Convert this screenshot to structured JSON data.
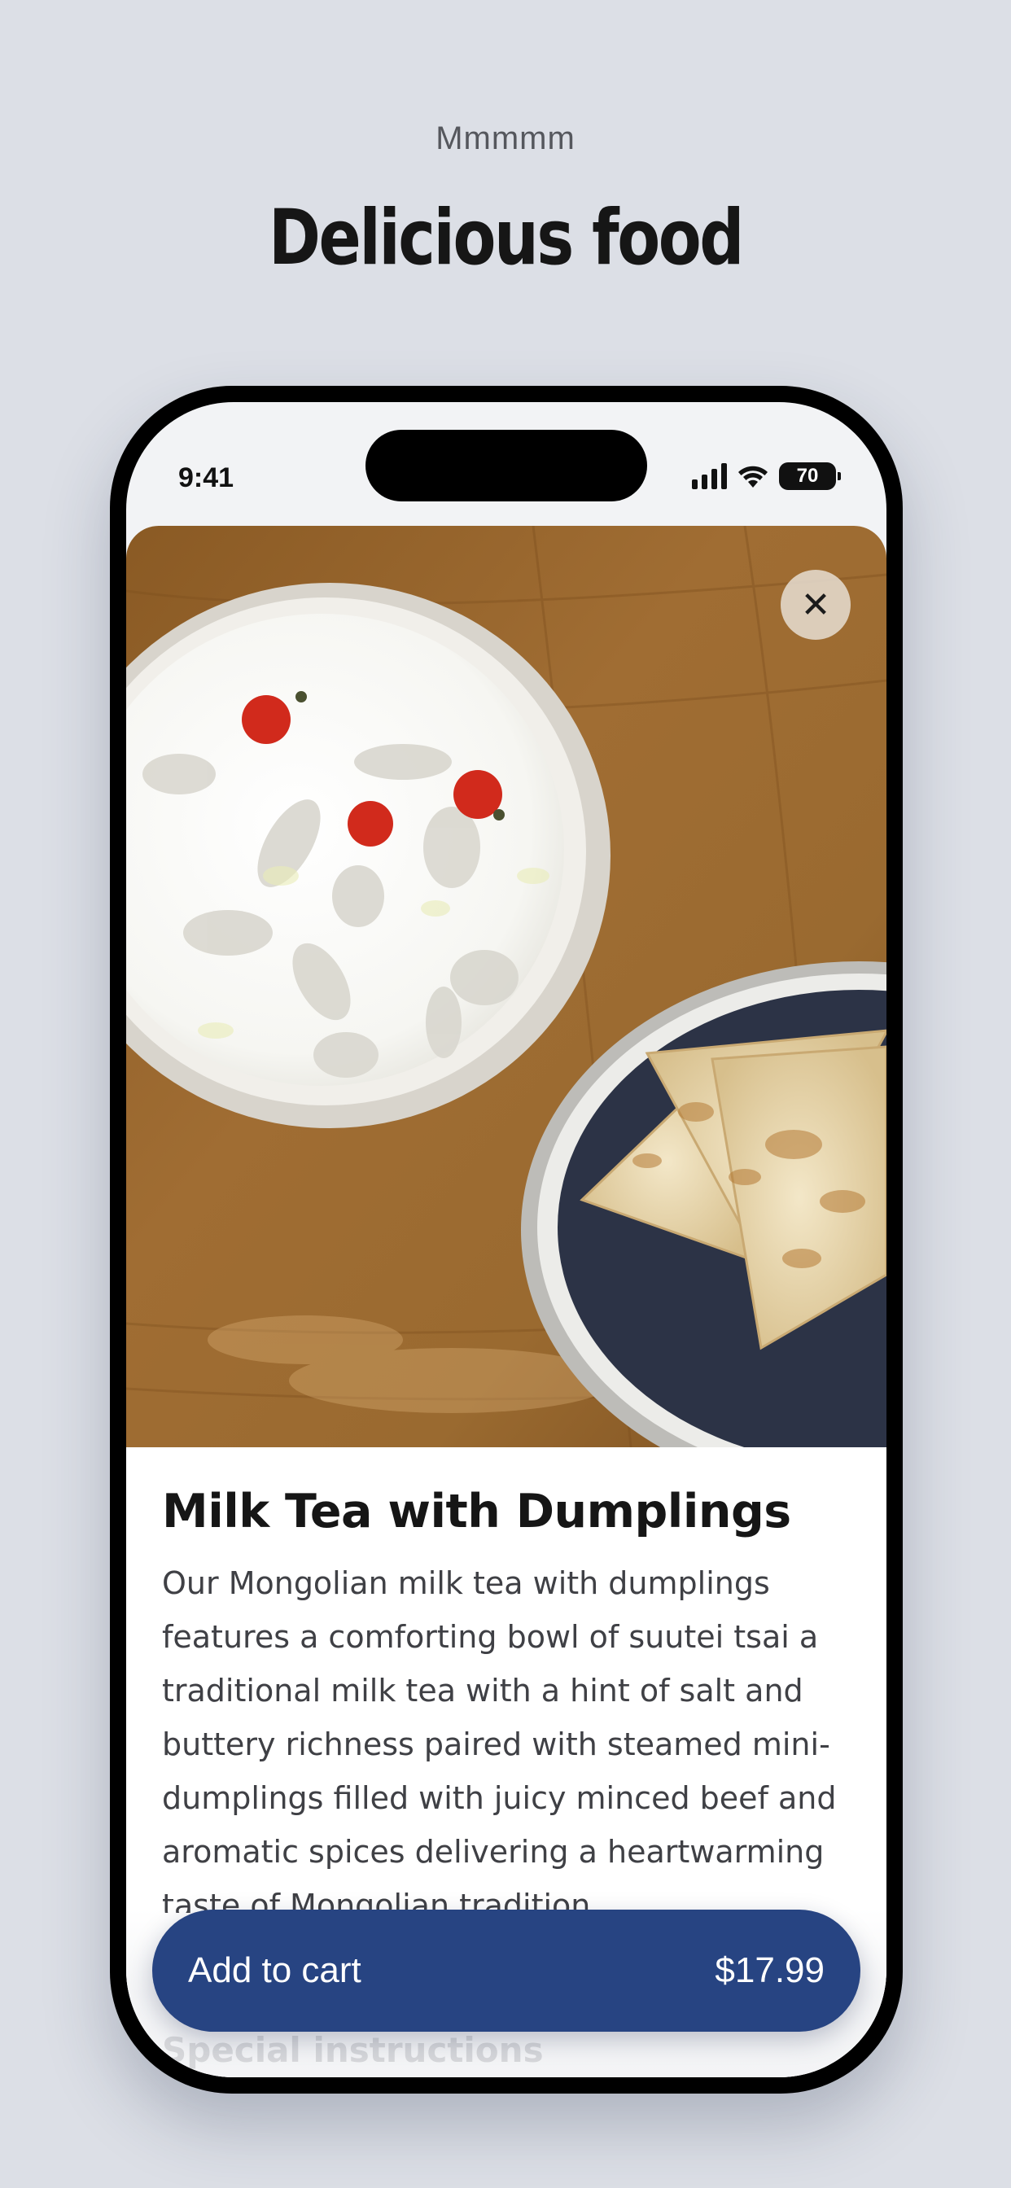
{
  "page": {
    "eyebrow": "Mmmmm",
    "headline": "Delicious food"
  },
  "status_bar": {
    "time": "9:41",
    "battery": "70",
    "icons": [
      "signal-icon",
      "wifi-icon",
      "battery-icon"
    ]
  },
  "item": {
    "close_icon": "close-icon",
    "title": "Milk Tea with Dumplings",
    "description": "Our Mongolian milk tea with dumplings features a comforting bowl of suutei tsai a traditional milk tea with a hint of salt and buttery richness paired with steamed mini-dumplings filled with juicy minced beef and aromatic spices delivering a heartwarming taste of Mongolian tradition.",
    "special_instructions_label": "Special instructions"
  },
  "cart": {
    "label": "Add to cart",
    "price": "$17.99",
    "color": "#274482"
  }
}
